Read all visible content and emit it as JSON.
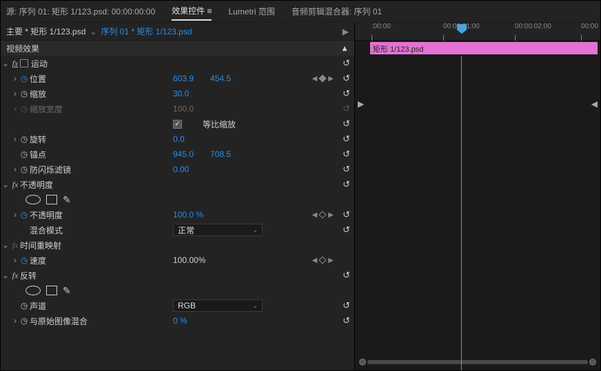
{
  "tabs": {
    "source": "源: 序列 01: 矩形 1/123.psd: 00:00:00:00",
    "effect_controls": "效果控件",
    "lumetri": "Lumetri 范围",
    "audio_mixer": "音频剪辑混合器: 序列 01"
  },
  "breadcrumb": {
    "master": "主要 * 矩形 1/123.psd",
    "seq": "序列 01 * 矩形 1/123.psd"
  },
  "section_header": "视频效果",
  "effects": {
    "motion": {
      "name": "运动",
      "position_label": "位置",
      "position_x": "603.9",
      "position_y": "454.5",
      "scale_label": "缩放",
      "scale_value": "30.0",
      "scale_width_label": "缩放宽度",
      "scale_width_value": "100.0",
      "uniform_label": "等比缩放",
      "rotation_label": "旋转",
      "rotation_value": "0.0",
      "anchor_label": "锚点",
      "anchor_x": "945.0",
      "anchor_y": "708.5",
      "flicker_label": "防闪烁滤镜",
      "flicker_value": "0.00"
    },
    "opacity": {
      "name": "不透明度",
      "opacity_label": "不透明度",
      "opacity_value": "100.0 %",
      "blend_label": "混合模式",
      "blend_value": "正常"
    },
    "time_remap": {
      "name": "时间重映射",
      "speed_label": "速度",
      "speed_value": "100.00%"
    },
    "invert": {
      "name": "反转",
      "channel_label": "声道",
      "channel_value": "RGB",
      "blend_label": "与原始图像混合",
      "blend_value": "0 %"
    }
  },
  "timeline": {
    "clip_name": "矩形 1/123.psd",
    "ticks": [
      ":00:00",
      "00:00:01:00",
      "00:00:02:00",
      "00:00"
    ]
  }
}
